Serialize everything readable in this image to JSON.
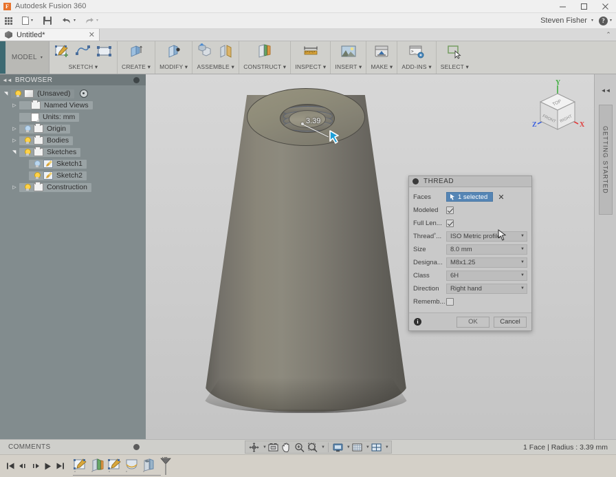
{
  "window": {
    "app_title": "Autodesk Fusion 360",
    "logo_letter": "F",
    "minimize": "–",
    "maximize": "☐",
    "close": "✕"
  },
  "quick_access": {
    "grid_icon": "app-grid-icon",
    "new_icon": "new-document-icon",
    "save_icon": "save-icon",
    "undo_icon": "undo-icon",
    "redo_icon": "redo-icon",
    "caret": "▾",
    "user_name": "Steven Fisher",
    "help_label": "?"
  },
  "doc_tabs": {
    "tabs": [
      {
        "label": "Untitled*",
        "close": "✕",
        "icon": "cube-icon"
      }
    ],
    "collapse_chevron": "⌃"
  },
  "ribbon": {
    "workspace": {
      "label": "MODEL",
      "caret": "▾"
    },
    "groups": [
      {
        "label": "SKETCH ▾",
        "icons": [
          "create-sketch-icon",
          "spline-icon",
          "rectangle-icon"
        ]
      },
      {
        "label": "CREATE ▾",
        "icons": [
          "extrude-icon"
        ]
      },
      {
        "label": "MODIFY ▾",
        "icons": [
          "press-pull-icon"
        ]
      },
      {
        "label": "ASSEMBLE ▾",
        "icons": [
          "new-component-icon",
          "joint-icon"
        ]
      },
      {
        "label": "CONSTRUCT ▾",
        "icons": [
          "offset-plane-icon"
        ]
      },
      {
        "label": "INSPECT ▾",
        "icons": [
          "measure-icon"
        ]
      },
      {
        "label": "INSERT ▾",
        "icons": [
          "insert-image-icon"
        ]
      },
      {
        "label": "MAKE ▾",
        "icons": [
          "3d-print-icon"
        ]
      },
      {
        "label": "ADD-INS ▾",
        "icons": [
          "scripts-addins-icon"
        ]
      },
      {
        "label": "SELECT ▾",
        "icons": [
          "select-icon"
        ]
      }
    ]
  },
  "browser": {
    "title": "BROWSER",
    "collapse_icon": "collapse-left-icon",
    "settings_icon": "browser-settings-icon",
    "tree": [
      {
        "label": "(Unsaved)",
        "indent": 0,
        "arrow": "open",
        "bulb": "on",
        "icon": "cube-icon",
        "eyeball": true,
        "highlight": "strong"
      },
      {
        "label": "Named Views",
        "indent": 1,
        "arrow": "closed",
        "bulb": "none",
        "icon": "folder-icon",
        "highlight": "on"
      },
      {
        "label": "Units: mm",
        "indent": 1,
        "arrow": "none",
        "bulb": "none",
        "icon": "document-icon",
        "highlight": "on"
      },
      {
        "label": "Origin",
        "indent": 1,
        "arrow": "closed",
        "bulb": "off",
        "icon": "folder-icon",
        "highlight": "on"
      },
      {
        "label": "Bodies",
        "indent": 1,
        "arrow": "closed",
        "bulb": "on",
        "icon": "folder-icon",
        "highlight": "on"
      },
      {
        "label": "Sketches",
        "indent": 1,
        "arrow": "open",
        "bulb": "on",
        "icon": "folder-icon",
        "highlight": "on"
      },
      {
        "label": "Sketch1",
        "indent": 2,
        "arrow": "none",
        "bulb": "off",
        "icon": "sketch-icon",
        "highlight": "on"
      },
      {
        "label": "Sketch2",
        "indent": 2,
        "arrow": "none",
        "bulb": "on",
        "icon": "sketch-icon",
        "highlight": "on"
      },
      {
        "label": "Construction",
        "indent": 1,
        "arrow": "closed",
        "bulb": "on",
        "icon": "folder-icon",
        "highlight": "on"
      }
    ]
  },
  "viewport": {
    "model_name": "threaded-cone-body",
    "dimension_annotation": "3.39",
    "cursor_icon": "blue-arrow-cursor",
    "viewcube": {
      "faces": {
        "top": "TOP",
        "front": "FRONT",
        "right": "RIGHT"
      },
      "axes": [
        {
          "name": "X",
          "color": "#e03a3a"
        },
        {
          "name": "Y",
          "color": "#3fae3f"
        },
        {
          "name": "Z",
          "color": "#3a5fe0"
        }
      ]
    }
  },
  "thread_dialog": {
    "title": "THREAD",
    "close_field_icon": "✕",
    "fields": {
      "faces": {
        "label": "Faces",
        "value": "1 selected",
        "cursor_icon": "select-cursor-icon"
      },
      "modeled": {
        "label": "Modeled",
        "checked": true
      },
      "full_length": {
        "label": "Full Len...",
        "checked": true
      },
      "thread_type": {
        "label": "Thread˚...",
        "value": "ISO Metric profile"
      },
      "size": {
        "label": "Size",
        "value": "8.0 mm"
      },
      "designation": {
        "label": "Designa...",
        "value": "M8x1.25"
      },
      "class": {
        "label": "Class",
        "value": "6H"
      },
      "direction": {
        "label": "Direction",
        "value": "Right hand"
      },
      "remember": {
        "label": "Rememb...",
        "checked": false
      }
    },
    "footer": {
      "info_icon": "i",
      "ok_label": "OK",
      "cancel_label": "Cancel"
    },
    "accent_color": "#5585b5"
  },
  "getting_started": {
    "label": "GETTING STARTED",
    "collapse_icon": "collapse-right-icon"
  },
  "status_bar": {
    "comments_label": "COMMENTS",
    "comments_settings_icon": "comments-settings-icon",
    "nav_tools": [
      {
        "name": "orbit-icon",
        "caret": true
      },
      {
        "name": "look-at-icon",
        "caret": false
      },
      {
        "name": "pan-icon",
        "caret": false
      },
      {
        "name": "zoom-icon",
        "caret": false
      },
      {
        "name": "fit-icon",
        "caret": true
      },
      {
        "name": "display-settings-icon",
        "caret": true
      },
      {
        "name": "grid-snaps-icon",
        "caret": true
      },
      {
        "name": "viewports-icon",
        "caret": true
      }
    ],
    "selection_info": "1 Face | Radius : 3.39 mm"
  },
  "timeline": {
    "playback": [
      {
        "name": "go-to-beginning-icon",
        "glyph": "⏮"
      },
      {
        "name": "step-back-icon",
        "glyph": "◀❘"
      },
      {
        "name": "step-forward-icon",
        "glyph": "❘▶"
      },
      {
        "name": "play-icon",
        "glyph": "▶"
      },
      {
        "name": "go-to-end-icon",
        "glyph": "⏭"
      }
    ],
    "features": [
      {
        "name": "sketch1-feature",
        "icon": "sketch-icon"
      },
      {
        "name": "revolve-feature",
        "icon": "revolve-icon"
      },
      {
        "name": "sketch2-feature",
        "icon": "sketch-icon"
      },
      {
        "name": "fillet-feature",
        "icon": "fillet-icon"
      },
      {
        "name": "hole-feature",
        "icon": "hole-icon"
      }
    ],
    "marker_icon": "timeline-marker-icon"
  }
}
